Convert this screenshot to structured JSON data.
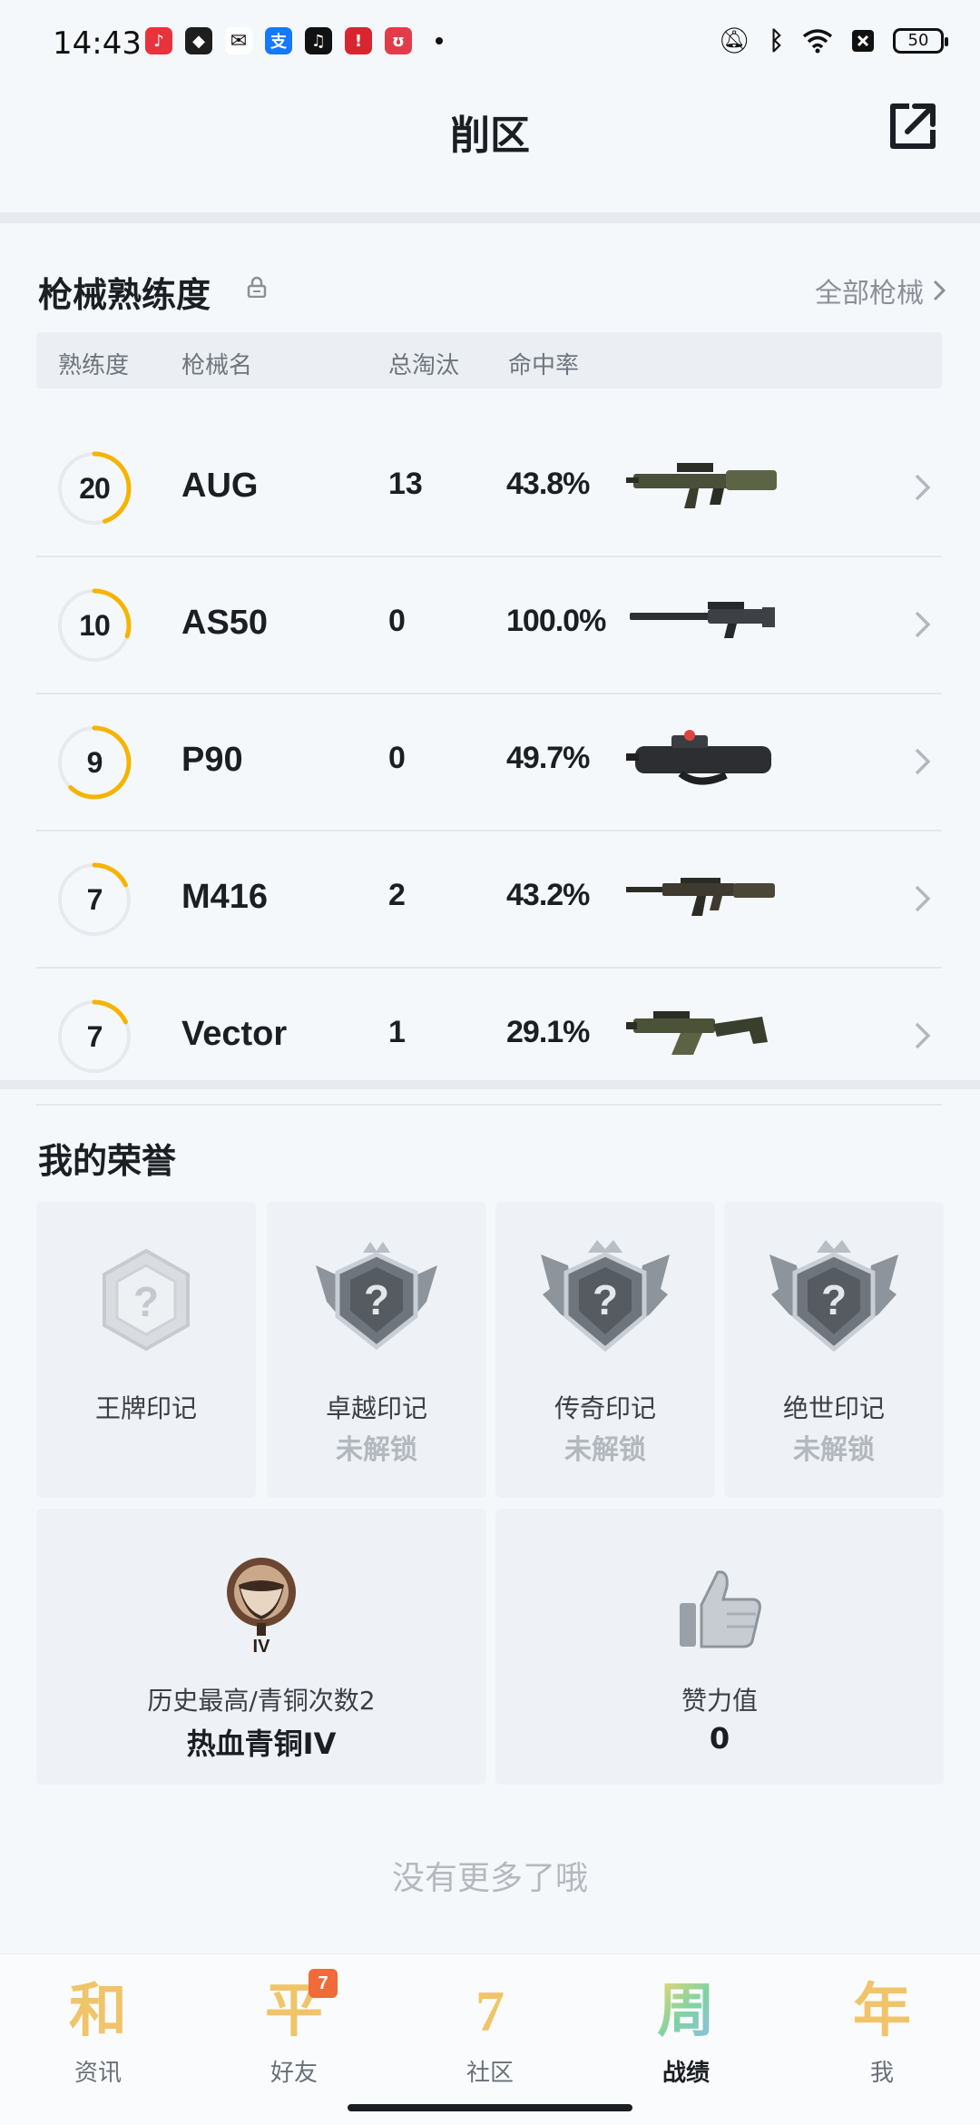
{
  "status_bar": {
    "time": "14:43",
    "battery": "50"
  },
  "header": {
    "title": "削区"
  },
  "proficiency": {
    "title": "枪械熟练度",
    "all_link": "全部枪械",
    "columns": {
      "level": "熟练度",
      "name": "枪械名",
      "kills": "总淘汰",
      "accuracy": "命中率"
    },
    "rows": [
      {
        "level": "20",
        "name": "AUG",
        "kills": "13",
        "accuracy": "43.8%",
        "progress": 0.45,
        "weapon_icon": "assault-rifle-bullpup"
      },
      {
        "level": "10",
        "name": "AS50",
        "kills": "0",
        "accuracy": "100.0%",
        "progress": 0.3,
        "weapon_icon": "sniper-rifle"
      },
      {
        "level": "9",
        "name": "P90",
        "kills": "0",
        "accuracy": "49.7%",
        "progress": 0.62,
        "weapon_icon": "smg-p90"
      },
      {
        "level": "7",
        "name": "M416",
        "kills": "2",
        "accuracy": "43.2%",
        "progress": 0.18,
        "weapon_icon": "assault-rifle"
      },
      {
        "level": "7",
        "name": "Vector",
        "kills": "1",
        "accuracy": "29.1%",
        "progress": 0.18,
        "weapon_icon": "smg-vector"
      }
    ],
    "colors": {
      "progress": "#f5b400",
      "track": "#e6e9ed"
    }
  },
  "honors": {
    "title": "我的荣誉",
    "cards": [
      {
        "name": "王牌印记",
        "status": "",
        "icon": "locked-hexagon-question-icon"
      },
      {
        "name": "卓越印记",
        "status": "未解锁",
        "icon": "silver-crown-badge-icon"
      },
      {
        "name": "传奇印记",
        "status": "未解锁",
        "icon": "silver-winged-crown-badge-icon"
      },
      {
        "name": "绝世印记",
        "status": "未解锁",
        "icon": "silver-winged-crown-badge-icon"
      }
    ],
    "rank": {
      "label": "历史最高/青铜次数2",
      "value": "热血青铜IV",
      "icon_text": "IV"
    },
    "likes": {
      "label": "赞力值",
      "value": "0"
    }
  },
  "footer": {
    "no_more": "没有更多了哦"
  },
  "bottom_nav": {
    "items": [
      {
        "glyph": "和",
        "label": "资讯",
        "badge": ""
      },
      {
        "glyph": "平",
        "label": "好友",
        "badge": "7"
      },
      {
        "glyph": "7",
        "label": "社区",
        "badge": ""
      },
      {
        "glyph": "周",
        "label": "战绩",
        "badge": ""
      },
      {
        "glyph": "年",
        "label": "我",
        "badge": ""
      }
    ],
    "active_index": 3
  }
}
